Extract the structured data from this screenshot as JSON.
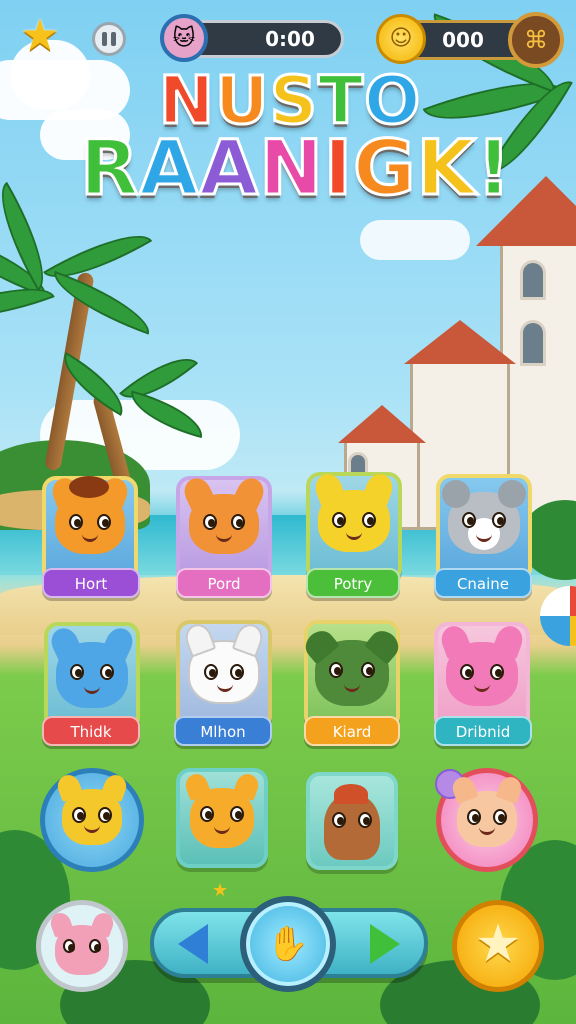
{
  "header": {
    "timer": "0:00",
    "coins": "000"
  },
  "title": {
    "line1": "NUSTO",
    "line2": "RAANIGK!"
  },
  "title_colors": [
    "#f04a2a",
    "#f78a1e",
    "#f4c21a",
    "#3fbf3a",
    "#2fa6e6",
    "#8b5cd6",
    "#e84aa8"
  ],
  "cards": [
    {
      "name": "Hort",
      "label_color": "#9b4fd6"
    },
    {
      "name": "Pord",
      "label_color": "#e46fc0"
    },
    {
      "name": "Potry",
      "label_color": "#4cbf3a"
    },
    {
      "name": "Cnaine",
      "label_color": "#3aa2df"
    },
    {
      "name": "Thidk",
      "label_color": "#e64a4a"
    },
    {
      "name": "Mlhon",
      "label_color": "#3a7fd6"
    },
    {
      "name": "Kiard",
      "label_color": "#f4a21e"
    },
    {
      "name": "Dribnid",
      "label_color": "#2fb4c2"
    }
  ],
  "icons": {
    "star": "star-icon",
    "pause": "pause-icon",
    "coin": "coin-icon",
    "shop": "shop-icon",
    "prev": "arrow-left-icon",
    "next": "arrow-right-icon"
  }
}
